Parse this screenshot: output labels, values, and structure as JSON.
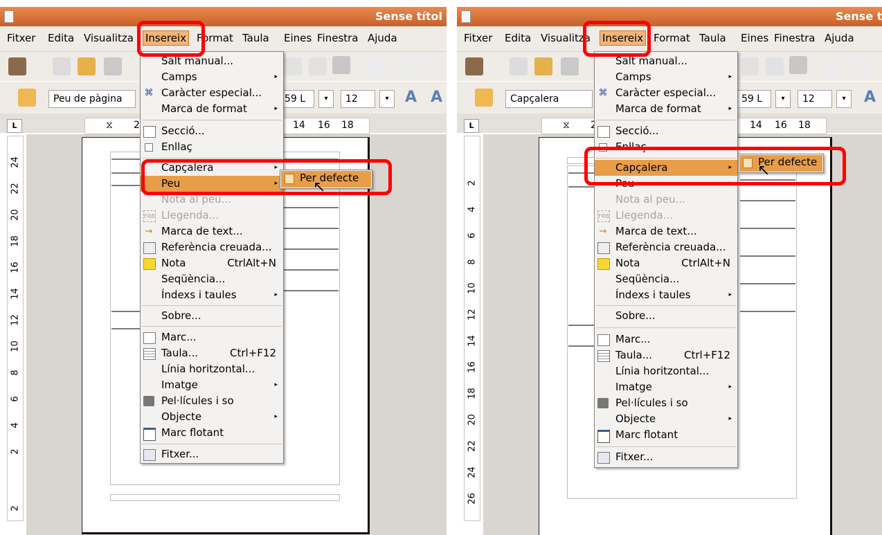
{
  "window": {
    "title": "Sense títol"
  },
  "menubar": {
    "items": [
      "Fitxer",
      "Edita",
      "Visualitza",
      "Insereix",
      "Format",
      "Taula",
      "Eines",
      "Finestra",
      "Ajuda"
    ],
    "active": "Insereix"
  },
  "toolbar": {
    "font_name_partial": "59 L",
    "font_size": "12"
  },
  "ruler": {
    "ticks": [
      "2",
      "14",
      "16",
      "18"
    ]
  },
  "left_panel": {
    "paragraph_style": "Peu de pàgina",
    "vruler_ticks": [
      "24",
      "22",
      "20",
      "18",
      "16",
      "14",
      "12",
      "10",
      "8",
      "6",
      "4",
      "2",
      "2"
    ],
    "submenu_item": "Per defecte",
    "highlighted_menu_item": "Peu"
  },
  "right_panel": {
    "paragraph_style": "Capçalera",
    "vruler_ticks": [
      "2",
      "4",
      "6",
      "8",
      "10",
      "12",
      "14",
      "16",
      "18",
      "20",
      "22",
      "24",
      "26"
    ],
    "submenu_item": "Per defecte",
    "highlighted_menu_item": "Capçalera"
  },
  "insert_menu": {
    "items": [
      {
        "label": "Salt manual...",
        "icon": "",
        "has_submenu": false,
        "disabled": false
      },
      {
        "label": "Camps",
        "icon": "",
        "has_submenu": true,
        "disabled": false
      },
      {
        "label": "Caràcter especial...",
        "icon": "command-icon",
        "has_submenu": false,
        "disabled": false
      },
      {
        "label": "Marca de format",
        "icon": "",
        "has_submenu": true,
        "disabled": false
      },
      {
        "label": "Secció...",
        "icon": "section-icon",
        "has_submenu": false,
        "disabled": false
      },
      {
        "label": "Enllaç",
        "icon": "link-checkbox-icon",
        "has_submenu": false,
        "disabled": false
      },
      {
        "label": "Capçalera",
        "icon": "",
        "has_submenu": true,
        "disabled": false
      },
      {
        "label": "Peu",
        "icon": "",
        "has_submenu": true,
        "disabled": false
      },
      {
        "label": "Nota al peu...",
        "icon": "",
        "has_submenu": false,
        "disabled": true
      },
      {
        "label": "Llegenda...",
        "icon": "caption-icon",
        "has_submenu": false,
        "disabled": true
      },
      {
        "label": "Marca de text...",
        "icon": "bookmark-icon",
        "has_submenu": false,
        "disabled": false
      },
      {
        "label": "Referència creuada...",
        "icon": "cross-reference-icon",
        "has_submenu": false,
        "disabled": false
      },
      {
        "label": "Nota",
        "accel": "CtrlAlt+N",
        "icon": "note-icon",
        "has_submenu": false,
        "disabled": false
      },
      {
        "label": "Seqüència...",
        "icon": "",
        "has_submenu": false,
        "disabled": false
      },
      {
        "label": "Índexs i taules",
        "icon": "",
        "has_submenu": true,
        "disabled": false
      },
      {
        "label": "Sobre...",
        "icon": "",
        "has_submenu": false,
        "disabled": false
      },
      {
        "label": "Marc...",
        "icon": "frame-icon",
        "has_submenu": false,
        "disabled": false
      },
      {
        "label": "Taula...",
        "accel": "Ctrl+F12",
        "icon": "table-icon",
        "has_submenu": false,
        "disabled": false
      },
      {
        "label": "Línia horitzontal...",
        "icon": "",
        "has_submenu": false,
        "disabled": false
      },
      {
        "label": "Imatge",
        "icon": "",
        "has_submenu": true,
        "disabled": false
      },
      {
        "label": "Pel·lícules i so",
        "icon": "movie-icon",
        "has_submenu": false,
        "disabled": false
      },
      {
        "label": "Objecte",
        "icon": "",
        "has_submenu": true,
        "disabled": false
      },
      {
        "label": "Marc flotant",
        "icon": "floating-frame-icon",
        "has_submenu": false,
        "disabled": false
      },
      {
        "label": "Fitxer...",
        "icon": "file-icon",
        "has_submenu": false,
        "disabled": false
      }
    ]
  },
  "colors": {
    "titlebar": "#d9763a",
    "highlight": "#e89d48",
    "annotation_red": "#ff0000",
    "menu_bg": "#f4f2f0"
  }
}
